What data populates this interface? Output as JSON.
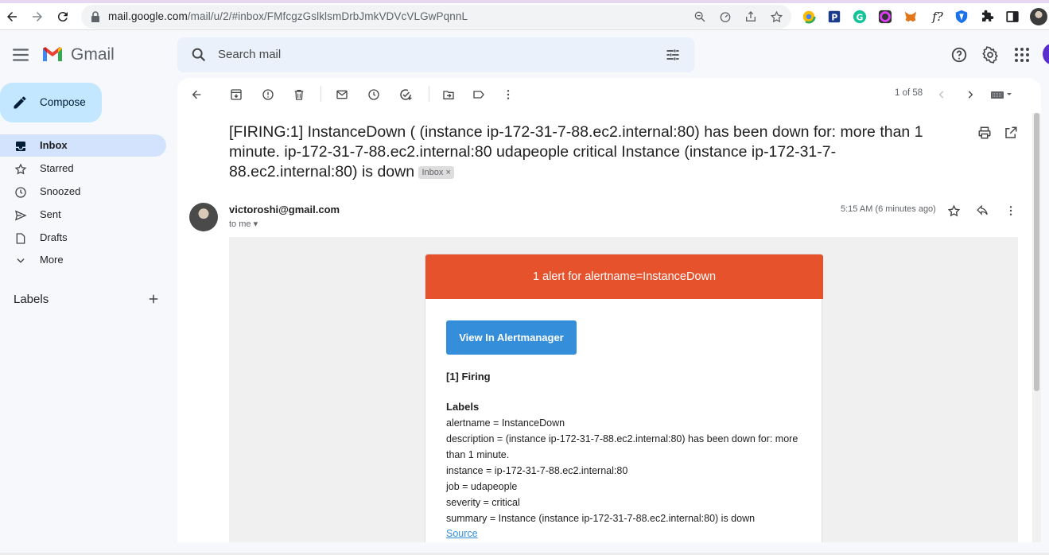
{
  "browser": {
    "url_host": "mail.google.com",
    "url_path": "/mail/u/2/#inbox/FMfcgzGslklsmDrbJmkVDVcVLGwPqnnL",
    "extension_f_label": "f?"
  },
  "header": {
    "app_name": "Gmail",
    "search_placeholder": "Search mail"
  },
  "sidebar": {
    "compose_label": "Compose",
    "items": [
      {
        "label": "Inbox",
        "icon": "inbox-icon",
        "active": true
      },
      {
        "label": "Starred",
        "icon": "star-icon"
      },
      {
        "label": "Snoozed",
        "icon": "clock-icon"
      },
      {
        "label": "Sent",
        "icon": "send-icon"
      },
      {
        "label": "Drafts",
        "icon": "draft-icon"
      },
      {
        "label": "More",
        "icon": "chevron-down-icon"
      }
    ],
    "labels_title": "Labels"
  },
  "toolbar": {
    "pager": "1 of 58"
  },
  "message": {
    "subject": "[FIRING:1] InstanceDown ( (instance ip-172-31-7-88.ec2.internal:80) has been down for: more than 1 minute. ip-172-31-7-88.ec2.internal:80 udapeople critical Instance (instance ip-172-31-7-88.ec2.internal:80) is down",
    "inbox_chip": "Inbox",
    "sender": "victoroshi@gmail.com",
    "to": "to me",
    "time": "5:15 AM (6 minutes ago)"
  },
  "alert": {
    "header": "1 alert for alertname=InstanceDown",
    "button": "View In Alertmanager",
    "firing": "[1] Firing",
    "labels_heading": "Labels",
    "lines": [
      "alertname = InstanceDown",
      "description = (instance ip-172-31-7-88.ec2.internal:80) has been down for: more",
      "than 1 minute.",
      "instance = ip-172-31-7-88.ec2.internal:80",
      "job = udapeople",
      "severity = critical",
      "summary = Instance (instance ip-172-31-7-88.ec2.internal:80) is down"
    ],
    "source": "Source"
  },
  "colors": {
    "alert_header": "#e6522c",
    "alert_button": "#348eda",
    "active_nav": "#d3e3fd",
    "compose": "#c2e7ff"
  }
}
